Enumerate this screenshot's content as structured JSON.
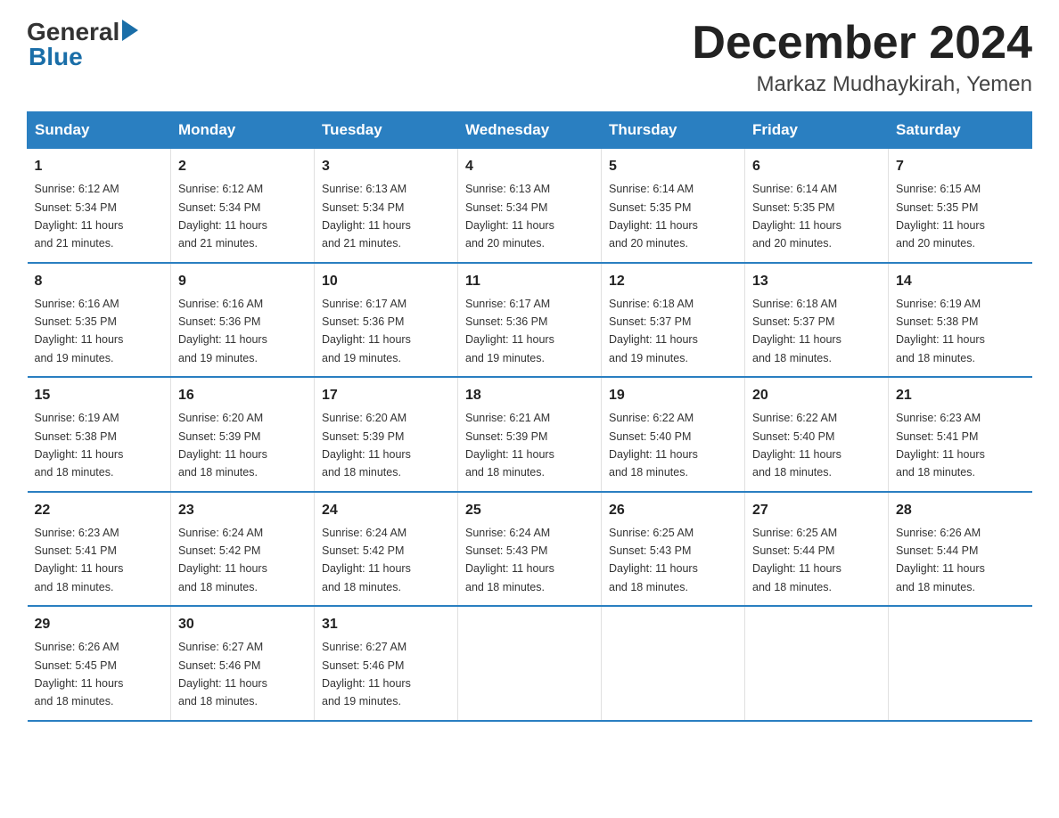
{
  "logo": {
    "general": "General",
    "blue": "Blue"
  },
  "title": "December 2024",
  "subtitle": "Markaz Mudhaykirah, Yemen",
  "days_of_week": [
    "Sunday",
    "Monday",
    "Tuesday",
    "Wednesday",
    "Thursday",
    "Friday",
    "Saturday"
  ],
  "weeks": [
    [
      {
        "day": "1",
        "sunrise": "6:12 AM",
        "sunset": "5:34 PM",
        "daylight": "11 hours and 21 minutes."
      },
      {
        "day": "2",
        "sunrise": "6:12 AM",
        "sunset": "5:34 PM",
        "daylight": "11 hours and 21 minutes."
      },
      {
        "day": "3",
        "sunrise": "6:13 AM",
        "sunset": "5:34 PM",
        "daylight": "11 hours and 21 minutes."
      },
      {
        "day": "4",
        "sunrise": "6:13 AM",
        "sunset": "5:34 PM",
        "daylight": "11 hours and 20 minutes."
      },
      {
        "day": "5",
        "sunrise": "6:14 AM",
        "sunset": "5:35 PM",
        "daylight": "11 hours and 20 minutes."
      },
      {
        "day": "6",
        "sunrise": "6:14 AM",
        "sunset": "5:35 PM",
        "daylight": "11 hours and 20 minutes."
      },
      {
        "day": "7",
        "sunrise": "6:15 AM",
        "sunset": "5:35 PM",
        "daylight": "11 hours and 20 minutes."
      }
    ],
    [
      {
        "day": "8",
        "sunrise": "6:16 AM",
        "sunset": "5:35 PM",
        "daylight": "11 hours and 19 minutes."
      },
      {
        "day": "9",
        "sunrise": "6:16 AM",
        "sunset": "5:36 PM",
        "daylight": "11 hours and 19 minutes."
      },
      {
        "day": "10",
        "sunrise": "6:17 AM",
        "sunset": "5:36 PM",
        "daylight": "11 hours and 19 minutes."
      },
      {
        "day": "11",
        "sunrise": "6:17 AM",
        "sunset": "5:36 PM",
        "daylight": "11 hours and 19 minutes."
      },
      {
        "day": "12",
        "sunrise": "6:18 AM",
        "sunset": "5:37 PM",
        "daylight": "11 hours and 19 minutes."
      },
      {
        "day": "13",
        "sunrise": "6:18 AM",
        "sunset": "5:37 PM",
        "daylight": "11 hours and 18 minutes."
      },
      {
        "day": "14",
        "sunrise": "6:19 AM",
        "sunset": "5:38 PM",
        "daylight": "11 hours and 18 minutes."
      }
    ],
    [
      {
        "day": "15",
        "sunrise": "6:19 AM",
        "sunset": "5:38 PM",
        "daylight": "11 hours and 18 minutes."
      },
      {
        "day": "16",
        "sunrise": "6:20 AM",
        "sunset": "5:39 PM",
        "daylight": "11 hours and 18 minutes."
      },
      {
        "day": "17",
        "sunrise": "6:20 AM",
        "sunset": "5:39 PM",
        "daylight": "11 hours and 18 minutes."
      },
      {
        "day": "18",
        "sunrise": "6:21 AM",
        "sunset": "5:39 PM",
        "daylight": "11 hours and 18 minutes."
      },
      {
        "day": "19",
        "sunrise": "6:22 AM",
        "sunset": "5:40 PM",
        "daylight": "11 hours and 18 minutes."
      },
      {
        "day": "20",
        "sunrise": "6:22 AM",
        "sunset": "5:40 PM",
        "daylight": "11 hours and 18 minutes."
      },
      {
        "day": "21",
        "sunrise": "6:23 AM",
        "sunset": "5:41 PM",
        "daylight": "11 hours and 18 minutes."
      }
    ],
    [
      {
        "day": "22",
        "sunrise": "6:23 AM",
        "sunset": "5:41 PM",
        "daylight": "11 hours and 18 minutes."
      },
      {
        "day": "23",
        "sunrise": "6:24 AM",
        "sunset": "5:42 PM",
        "daylight": "11 hours and 18 minutes."
      },
      {
        "day": "24",
        "sunrise": "6:24 AM",
        "sunset": "5:42 PM",
        "daylight": "11 hours and 18 minutes."
      },
      {
        "day": "25",
        "sunrise": "6:24 AM",
        "sunset": "5:43 PM",
        "daylight": "11 hours and 18 minutes."
      },
      {
        "day": "26",
        "sunrise": "6:25 AM",
        "sunset": "5:43 PM",
        "daylight": "11 hours and 18 minutes."
      },
      {
        "day": "27",
        "sunrise": "6:25 AM",
        "sunset": "5:44 PM",
        "daylight": "11 hours and 18 minutes."
      },
      {
        "day": "28",
        "sunrise": "6:26 AM",
        "sunset": "5:44 PM",
        "daylight": "11 hours and 18 minutes."
      }
    ],
    [
      {
        "day": "29",
        "sunrise": "6:26 AM",
        "sunset": "5:45 PM",
        "daylight": "11 hours and 18 minutes."
      },
      {
        "day": "30",
        "sunrise": "6:27 AM",
        "sunset": "5:46 PM",
        "daylight": "11 hours and 18 minutes."
      },
      {
        "day": "31",
        "sunrise": "6:27 AM",
        "sunset": "5:46 PM",
        "daylight": "11 hours and 19 minutes."
      },
      null,
      null,
      null,
      null
    ]
  ],
  "labels": {
    "sunrise": "Sunrise:",
    "sunset": "Sunset:",
    "daylight": "Daylight:"
  }
}
